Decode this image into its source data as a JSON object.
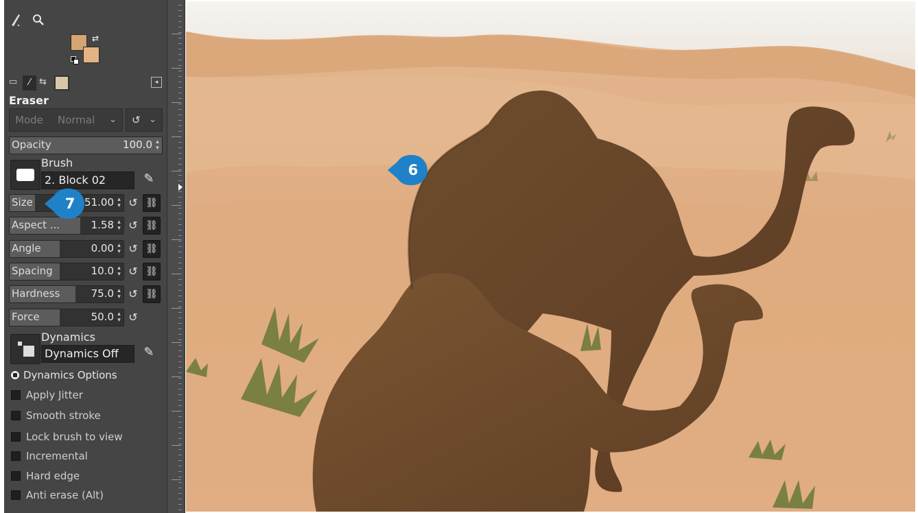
{
  "tool_options": {
    "title": "Eraser",
    "mode_label": "Mode",
    "mode_value": "Normal",
    "opacity": {
      "label": "Opacity",
      "value": "100.0"
    },
    "brush": {
      "label": "Brush",
      "value": "2. Block 02"
    },
    "sliders": [
      {
        "label": "Size",
        "value": "51.00",
        "fill": 0.22
      },
      {
        "label": "Aspect ...",
        "value": "1.58",
        "fill": 0.62
      },
      {
        "label": "Angle",
        "value": "0.00",
        "fill": 0.44
      },
      {
        "label": "Spacing",
        "value": "10.0",
        "fill": 0.44
      },
      {
        "label": "Hardness",
        "value": "75.0",
        "fill": 0.58
      },
      {
        "label": "Force",
        "value": "50.0",
        "fill": 0.44
      }
    ],
    "dynamics": {
      "label": "Dynamics",
      "value": "Dynamics Off"
    },
    "dynamics_options_label": "Dynamics Options",
    "options": [
      "Apply Jitter",
      "Smooth stroke",
      "Lock brush to view",
      "Incremental",
      "Hard edge",
      "Anti erase  (Alt)"
    ]
  },
  "callouts": [
    {
      "number": "6",
      "color": "#1f82c8"
    },
    {
      "number": "7",
      "color": "#1f82c8"
    }
  ],
  "icons": [
    "paintbrush-icon",
    "zoom-icon",
    "fg-bg-color-swatch",
    "swap-colors-icon",
    "reset-icon",
    "chain-link-icon",
    "edit-icon"
  ]
}
